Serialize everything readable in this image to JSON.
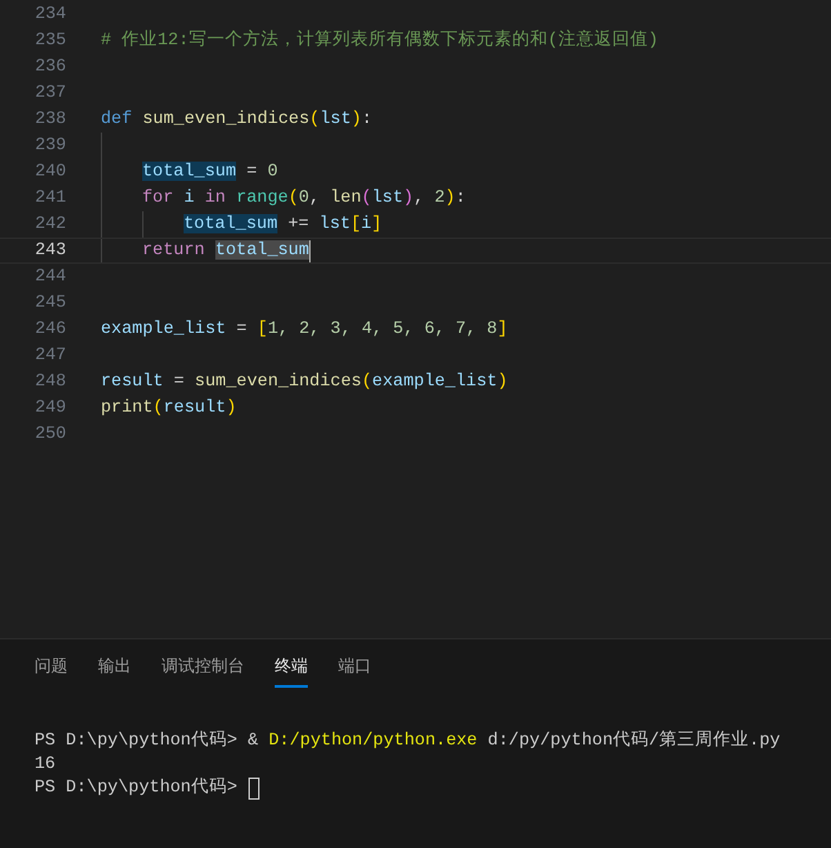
{
  "editor": {
    "lines": [
      {
        "number": "234",
        "current": false
      },
      {
        "number": "235",
        "current": false,
        "tokens": [
          {
            "text": "# 作业12:写一个方法，计算列表所有偶数下标元素的和(注意返回值)",
            "kind": "comment"
          }
        ]
      },
      {
        "number": "236",
        "current": false
      },
      {
        "number": "237",
        "current": false
      },
      {
        "number": "238",
        "current": false,
        "tokens": [
          {
            "text": "def ",
            "kind": "keyword"
          },
          {
            "text": "sum_even_indices",
            "kind": "function"
          },
          {
            "text": "(",
            "kind": "bracket1"
          },
          {
            "text": "lst",
            "kind": "variable"
          },
          {
            "text": ")",
            "kind": "bracket1"
          },
          {
            "text": ":",
            "kind": "plain"
          }
        ],
        "children": [
          {
            "number": "239",
            "current": false
          },
          {
            "number": "240",
            "current": false,
            "tokens": [
              {
                "text": "total_sum",
                "kind": "variable",
                "highlighted": true,
                "selected": false
              },
              {
                "text": " = ",
                "kind": "plain"
              },
              {
                "text": "0",
                "kind": "number"
              }
            ]
          },
          {
            "number": "241",
            "current": false,
            "tokens": [
              {
                "text": "for",
                "kind": "control"
              },
              {
                "text": " i ",
                "kind": "variable"
              },
              {
                "text": "in ",
                "kind": "control"
              },
              {
                "text": "range",
                "kind": "builtin"
              },
              {
                "text": "(",
                "kind": "bracket1"
              },
              {
                "text": "0",
                "kind": "number"
              },
              {
                "text": ", ",
                "kind": "plain"
              },
              {
                "text": "len",
                "kind": "function"
              },
              {
                "text": "(",
                "kind": "bracket2"
              },
              {
                "text": "lst",
                "kind": "variable"
              },
              {
                "text": ")",
                "kind": "bracket2"
              },
              {
                "text": ", ",
                "kind": "plain"
              },
              {
                "text": "2",
                "kind": "number"
              },
              {
                "text": ")",
                "kind": "bracket1"
              },
              {
                "text": ":",
                "kind": "plain"
              }
            ],
            "children": [
              {
                "number": "242",
                "current": false,
                "tokens": [
                  {
                    "text": "total_sum",
                    "kind": "variable",
                    "highlighted": true,
                    "selected": false
                  },
                  {
                    "text": " += ",
                    "kind": "plain"
                  },
                  {
                    "text": "lst",
                    "kind": "variable"
                  },
                  {
                    "text": "[",
                    "kind": "bracket1"
                  },
                  {
                    "text": "i",
                    "kind": "variable"
                  },
                  {
                    "text": "]",
                    "kind": "bracket1"
                  }
                ]
              }
            ]
          },
          {
            "number": "243",
            "current": true,
            "tokens": [
              {
                "text": "return ",
                "kind": "control"
              },
              {
                "text": "total_sum",
                "kind": "variable",
                "highlighted": false,
                "selected": true
              }
            ]
          }
        ]
      },
      {
        "number": "244",
        "current": false
      },
      {
        "number": "245",
        "current": false
      },
      {
        "number": "246",
        "current": false,
        "tokens": [
          {
            "text": "example_list",
            "kind": "variable"
          },
          {
            "text": " = ",
            "kind": "plain"
          },
          {
            "text": "[",
            "kind": "bracket1"
          },
          {
            "text": "1, 2, 3, 4, 5, 6, 7, 8",
            "kind": "number"
          },
          {
            "text": "]",
            "kind": "bracket1"
          }
        ]
      },
      {
        "number": "247",
        "current": false
      },
      {
        "number": "248",
        "current": false,
        "tokens": [
          {
            "text": "result",
            "kind": "variable"
          },
          {
            "text": " = ",
            "kind": "plain"
          },
          {
            "text": "sum_even_indices",
            "kind": "function"
          },
          {
            "text": "(",
            "kind": "bracket1"
          },
          {
            "text": "example_list",
            "kind": "variable"
          },
          {
            "text": ")",
            "kind": "bracket1"
          }
        ]
      },
      {
        "number": "249",
        "current": false,
        "tokens": [
          {
            "text": "print",
            "kind": "function"
          },
          {
            "text": "(",
            "kind": "bracket1"
          },
          {
            "text": "result",
            "kind": "variable"
          },
          {
            "text": ")",
            "kind": "bracket1"
          }
        ]
      },
      {
        "number": "250",
        "current": false
      }
    ]
  },
  "panel": {
    "tabs": [
      {
        "label": "问题",
        "selected": false
      },
      {
        "label": "输出",
        "selected": false
      },
      {
        "label": "调试控制台",
        "selected": false
      },
      {
        "label": "终端",
        "selected": true
      },
      {
        "label": "端口",
        "selected": false
      }
    ],
    "terminal": [
      {
        "cursor": false,
        "segments": [
          {
            "text": "PS D:\\py\\python代码> & ",
            "kind": "plain"
          },
          {
            "text": "D:/python/python.exe",
            "kind": "command"
          },
          {
            "text": " d:/py/python代码/第三周作业.py",
            "kind": "plain"
          }
        ]
      },
      {
        "cursor": false,
        "segments": [
          {
            "text": "16",
            "kind": "plain"
          }
        ]
      },
      {
        "cursor": true,
        "segments": [
          {
            "text": "PS D:\\py\\python代码>",
            "kind": "plain"
          }
        ]
      }
    ]
  }
}
